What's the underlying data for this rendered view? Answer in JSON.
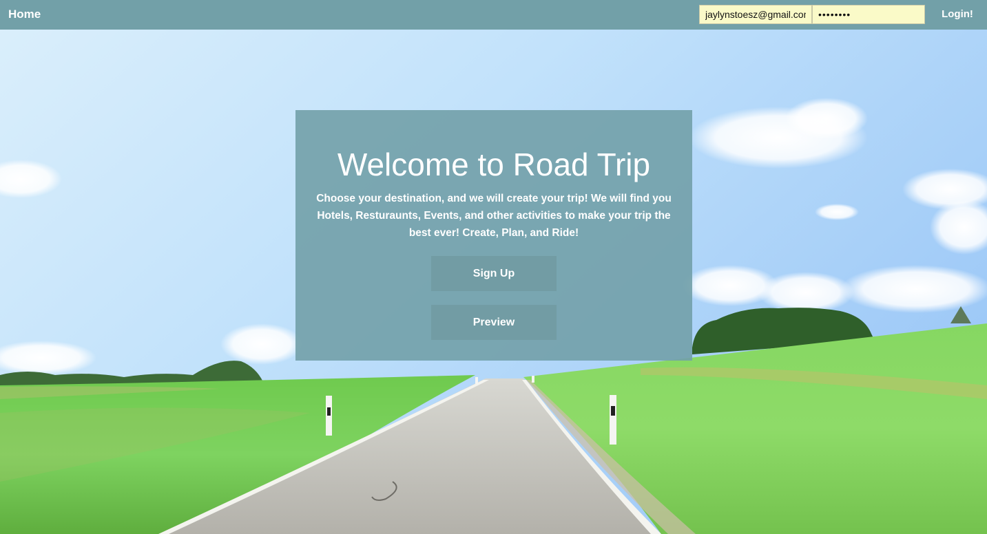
{
  "nav": {
    "home_label": "Home",
    "email_value": "jaylynstoesz@gmail.com",
    "password_value": "password",
    "login_label": "Login!"
  },
  "hero": {
    "title": "Welcome to Road Trip",
    "description": "Choose your destination, and we will create your trip! We will find you Hotels, Resturaunts, Events, and other activities to make your trip the best ever! Create, Plan, and Ride!",
    "signup_label": "Sign Up",
    "preview_label": "Preview"
  },
  "colors": {
    "navbar": "#72a0a8",
    "card": "#7aa6b0",
    "button": "#729ca4",
    "input_bg": "#fafac8",
    "sky": "#b9dcf5",
    "grass": "#7fd25a"
  }
}
